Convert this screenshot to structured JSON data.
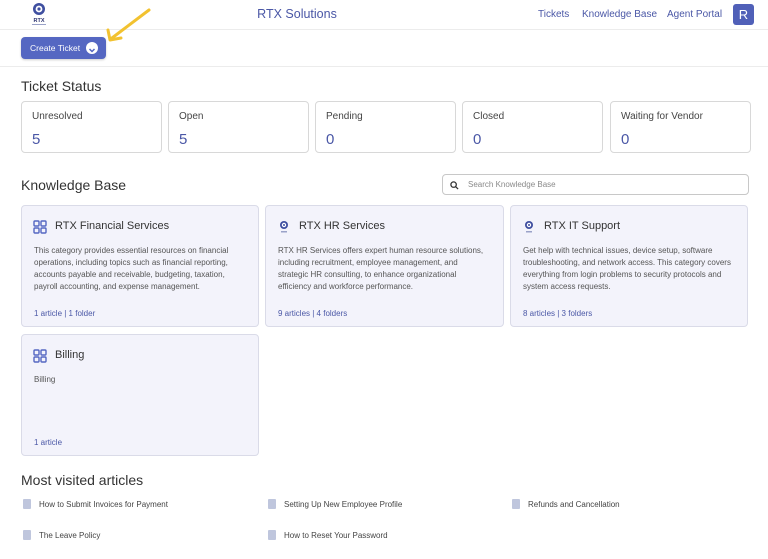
{
  "header": {
    "logo_text": "RTX",
    "brand": "RTX Solutions",
    "nav": {
      "tickets": "Tickets",
      "knowledge_base": "Knowledge Base",
      "agent_portal": "Agent Portal"
    },
    "avatar": "R"
  },
  "create_ticket_label": "Create Ticket",
  "ticket_status": {
    "heading": "Ticket Status",
    "cards": [
      {
        "label": "Unresolved",
        "value": "5"
      },
      {
        "label": "Open",
        "value": "5"
      },
      {
        "label": "Pending",
        "value": "0"
      },
      {
        "label": "Closed",
        "value": "0"
      },
      {
        "label": "Waiting for Vendor",
        "value": "0"
      }
    ]
  },
  "knowledge_base": {
    "heading": "Knowledge Base",
    "search_placeholder": "Search Knowledge Base",
    "categories": [
      {
        "title": "RTX Financial Services",
        "description": "This category provides essential resources on financial operations, including topics such as financial reporting, accounts payable and receivable, budgeting, taxation, payroll accounting, and expense management.",
        "articles": "1 article",
        "folders": "1 folder",
        "icon": "grid-icon"
      },
      {
        "title": "RTX HR Services",
        "description": "RTX HR Services offers expert human resource solutions, including recruitment, employee management, and strategic HR consulting, to enhance organizational efficiency and workforce performance.",
        "articles": "9 articles",
        "folders": "4 folders",
        "icon": "logo-icon"
      },
      {
        "title": "RTX IT Support",
        "description": "Get help with technical issues, device setup, software troubleshooting, and network access. This category covers everything from login problems to security protocols and system access requests.",
        "articles": "8 articles",
        "folders": "3 folders",
        "icon": "logo-icon"
      },
      {
        "title": "Billing",
        "description": "Billing",
        "articles": "1 article",
        "icon": "grid-icon"
      }
    ]
  },
  "most_visited": {
    "heading": "Most visited articles",
    "articles": [
      "How to Submit Invoices for Payment",
      "Setting Up New Employee Profile",
      "Refunds and Cancellation",
      "The Leave Policy",
      "How to Reset Your Password"
    ]
  },
  "colors": {
    "accent": "#5567c2",
    "link": "#4a57a6",
    "card_bg": "#f3f3fb",
    "arrow": "#f2c230"
  }
}
